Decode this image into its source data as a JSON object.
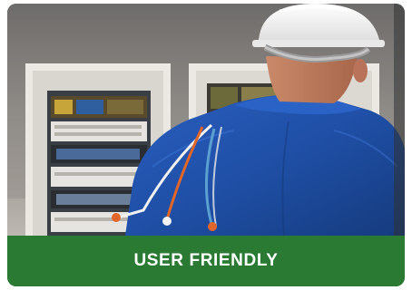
{
  "card": {
    "caption": "USER FRIENDLY",
    "image_subject": "electrician-at-electrical-panel",
    "colors": {
      "caption_bar": "#2b7a33",
      "caption_text": "#ffffff",
      "uniform": "#1f4fa6",
      "helmet": "#f2f2f2"
    }
  }
}
